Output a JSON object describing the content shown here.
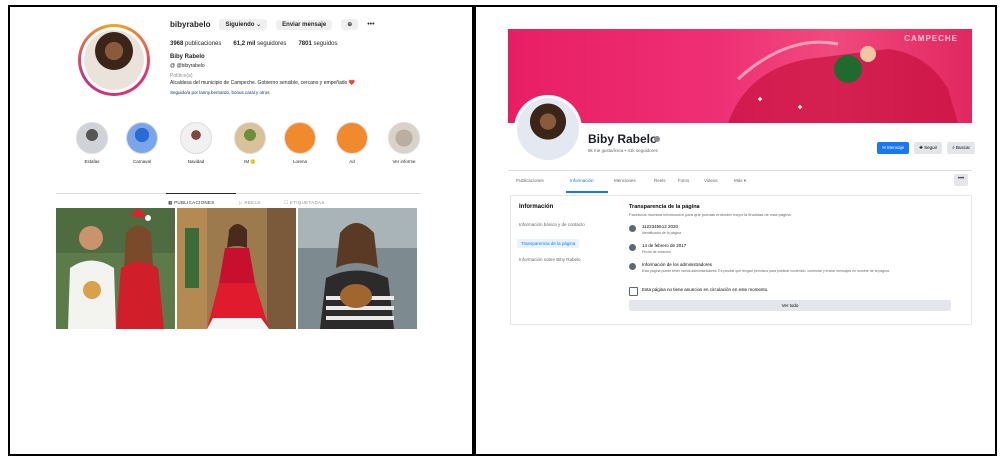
{
  "instagram": {
    "username": "bibyrabelo",
    "following_btn": "Siguiendo",
    "message_btn": "Enviar mensaje",
    "more": "•••",
    "stats": [
      {
        "num": "3968",
        "label": "publicaciones"
      },
      {
        "num": "61,2 mil",
        "label": "seguidores"
      },
      {
        "num": "7801",
        "label": "seguidos"
      }
    ],
    "full_name": "Biby Rabelo",
    "handle": "@bibyrabelo",
    "category": "Político(a)",
    "bio": "Alcaldesa del municipio de Campeche. Gobierno sensible, cercano y empeñado ❤️",
    "bio_link": "Seguido/a por lanny.bernardo, bonus.caral y otros",
    "highlights": [
      "Estafas",
      "Carnaval",
      "Navidad",
      "IM 🙂",
      "Lorena",
      "Ad",
      "Ver informe"
    ],
    "tabs": [
      "PUBLICACIONES",
      "REELS",
      "ETIQUETADAS"
    ]
  },
  "facebook": {
    "cover_text": "CAMPECHE",
    "name": "Biby Rabelo",
    "subtitle": "8k me gusta/ínica • 41k seguidores",
    "actions": [
      "Mensaje",
      "Seguir",
      "Buscar"
    ],
    "nav": [
      "Publicaciones",
      "Información",
      "Menciones",
      "Reels",
      "Fotos",
      "Videos",
      "Más ▾"
    ],
    "nav_more": "•••",
    "sidebar_title": "Información",
    "sidebar_items": [
      "Información básica y de contacto",
      "Transparencia de la página",
      "Información sobre Biby Rabelo"
    ],
    "main_title": "Transparencia de la página",
    "main_desc": "Facebook muestra información para que puedas entender mejor la finalidad de esta página.",
    "rows": [
      {
        "title": "1122345612 2020",
        "sub": "Identificador de la página"
      },
      {
        "title": "14 de febrero de 2017",
        "sub": "Fecha de creación"
      },
      {
        "title": "Información de los administradores",
        "sub": "Esta página puede tener varios administradores. Es posible que tengan permisos para publicar contenido, comentar y enviar mensajes en nombre de la página."
      }
    ],
    "ads_notice": "Esta página no tiene anuncios en circulación en este momento.",
    "see_all": "Ver todo"
  }
}
